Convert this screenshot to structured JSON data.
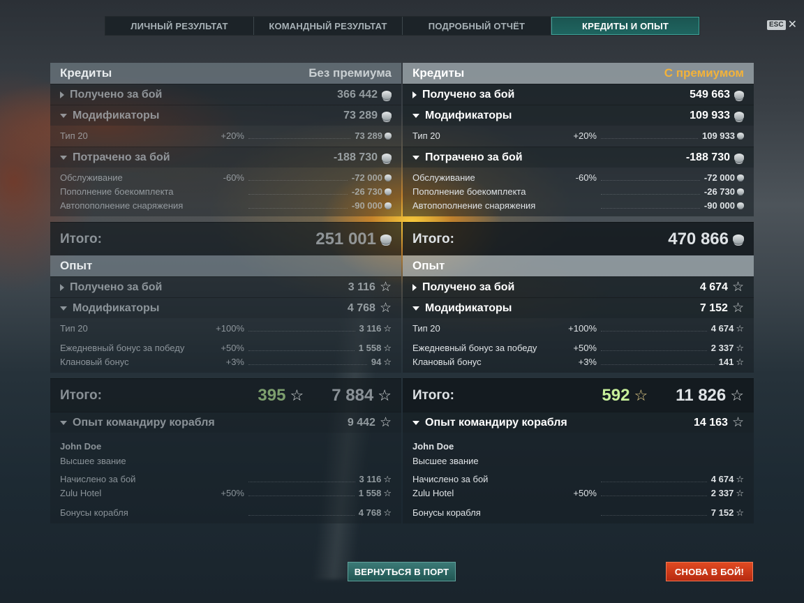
{
  "tabs": [
    "ЛИЧНЫЙ РЕЗУЛЬТАТ",
    "КОМАНДНЫЙ РЕЗУЛЬТАТ",
    "ПОДРОБНЫЙ ОТЧЁТ",
    "КРЕДИТЫ И ОПЫТ"
  ],
  "esc": "ESC",
  "left": {
    "credits_title": "Кредиты",
    "mode": "Без премиума",
    "earned_label": "Получено за бой",
    "earned": "366 442",
    "mods_label": "Модификаторы",
    "mods": "73 289",
    "type_name": "Тип 20",
    "type_pct": "+20%",
    "type_val": "73 289",
    "spent_label": "Потрачено за бой",
    "spent": "-188 730",
    "service": "Обслуживание",
    "service_pct": "-60%",
    "service_val": "-72 000",
    "ammo": "Пополнение боекомплекта",
    "ammo_val": "-26 730",
    "auto": "Автопополнение снаряжения",
    "auto_val": "-90 000",
    "total_label": "Итого:",
    "total": "251 001",
    "exp_title": "Опыт",
    "exp_earned": "3 116",
    "exp_mods": "4 768",
    "exp_type_val": "3 116",
    "exp_type_pct": "+100%",
    "daily": "Ежедневный бонус за победу",
    "daily_pct": "+50%",
    "daily_val": "1 558",
    "clan": "Клановый бонус",
    "clan_pct": "+3%",
    "clan_val": "94",
    "free_exp": "395",
    "exp_total": "7 884",
    "cmd_label": "Опыт командиру корабля",
    "cmd_val": "9 442",
    "cmd_name": "John Doe",
    "cmd_rank": "Высшее звание",
    "accrued": "Начислено за бой",
    "accrued_val": "3 116",
    "zulu": "Zulu Hotel",
    "zulu_pct": "+50%",
    "zulu_val": "1 558",
    "ship_bonus": "Бонусы корабля",
    "ship_bonus_val": "4 768"
  },
  "right": {
    "credits_title": "Кредиты",
    "mode": "С премиумом",
    "earned_label": "Получено за бой",
    "earned": "549 663",
    "mods_label": "Модификаторы",
    "mods": "109 933",
    "type_name": "Тип 20",
    "type_pct": "+20%",
    "type_val": "109 933",
    "spent_label": "Потрачено за бой",
    "spent": "-188 730",
    "service": "Обслуживание",
    "service_pct": "-60%",
    "service_val": "-72 000",
    "ammo": "Пополнение боекомплекта",
    "ammo_val": "-26 730",
    "auto": "Автопополнение снаряжения",
    "auto_val": "-90 000",
    "total_label": "Итого:",
    "total": "470 866",
    "exp_title": "Опыт",
    "exp_earned": "4 674",
    "exp_mods": "7 152",
    "exp_type_val": "4 674",
    "exp_type_pct": "+100%",
    "daily": "Ежедневный бонус за победу",
    "daily_pct": "+50%",
    "daily_val": "2 337",
    "clan": "Клановый бонус",
    "clan_pct": "+3%",
    "clan_val": "141",
    "free_exp": "592",
    "exp_total": "11 826",
    "cmd_label": "Опыт командиру корабля",
    "cmd_val": "14 163",
    "cmd_name": "John Doe",
    "cmd_rank": "Высшее звание",
    "accrued": "Начислено за бой",
    "accrued_val": "4 674",
    "zulu": "Zulu Hotel",
    "zulu_pct": "+50%",
    "zulu_val": "2 337",
    "ship_bonus": "Бонусы корабля",
    "ship_bonus_val": "7 152"
  },
  "buttons": {
    "port": "ВЕРНУТЬСЯ В ПОРТ",
    "battle": "СНОВА В БОЙ!"
  },
  "icons": {
    "coin": "credits-coin-icon",
    "star": "experience-star-icon",
    "close": "close-icon"
  },
  "colors": {
    "premium": "#f2b23a",
    "active_tab": "#1f6560",
    "battle_button": "#c8361a",
    "port_button": "#2b6764",
    "free_exp_premium": "#c7ef9a"
  }
}
